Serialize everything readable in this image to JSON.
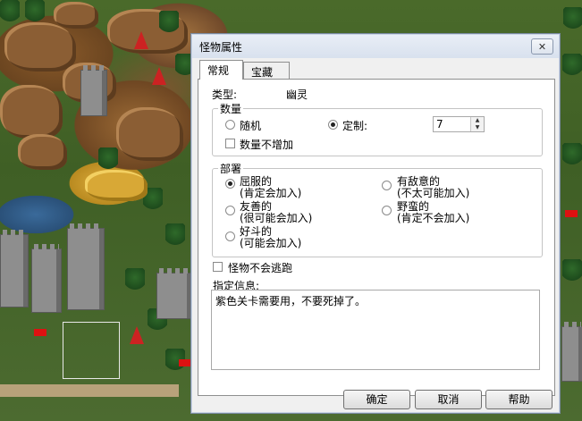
{
  "dialog": {
    "title": "怪物属性",
    "close_glyph": "✕",
    "tabs": [
      {
        "label": "常规",
        "selected": true
      },
      {
        "label": "宝藏",
        "selected": false
      }
    ],
    "type_label": "类型:",
    "type_value": "幽灵",
    "quantity": {
      "title": "数量",
      "random_label": "随机",
      "custom_label": "定制:",
      "custom_selected": true,
      "custom_value": "7",
      "no_grow_label": "数量不增加",
      "no_grow_checked": false
    },
    "disposition": {
      "title": "部署",
      "options": [
        {
          "line1": "屈服的",
          "line2": "(肯定会加入)",
          "selected": true
        },
        {
          "line1": "有敌意的",
          "line2": "(不太可能加入)",
          "selected": false
        },
        {
          "line1": "友善的",
          "line2": "(很可能会加入)",
          "selected": false
        },
        {
          "line1": "野蛮的",
          "line2": "(肯定不会加入)",
          "selected": false
        },
        {
          "line1": "好斗的",
          "line2": "(可能会加入)",
          "selected": false
        }
      ]
    },
    "never_flee_label": "怪物不会逃跑",
    "never_flee_checked": false,
    "message_label": "指定信息:",
    "message_text": "紫色关卡需要用，不要死掉了。",
    "buttons": {
      "ok": "确定",
      "cancel": "取消",
      "help": "帮助"
    }
  },
  "colors": {
    "accent_flag": "#d11",
    "crystal": "#c22",
    "titlebar": "#dde4ee"
  }
}
